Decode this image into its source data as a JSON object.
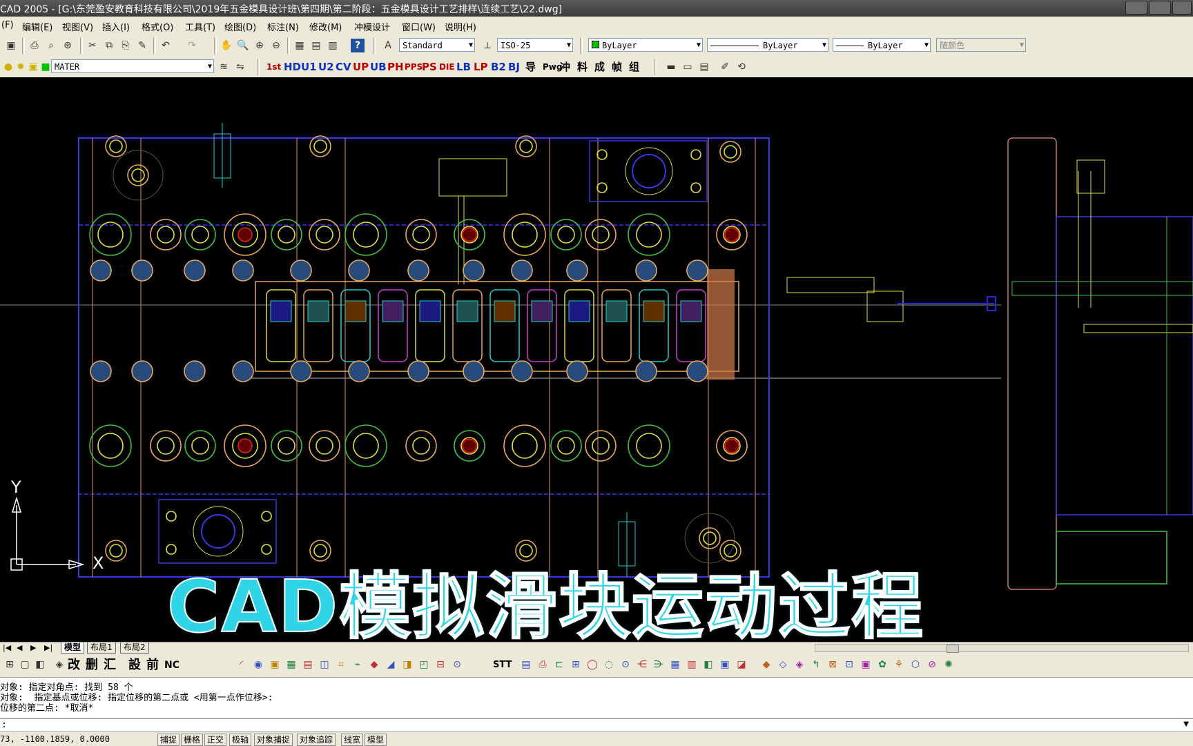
{
  "window": {
    "title": "CAD 2005 - [G:\\东莞盈安教育科技有限公司\\2019年五金模具设计班\\第四期\\第二阶段：五金模具设计工艺排样\\连续工艺\\22.dwg]"
  },
  "menu": {
    "items": [
      "(F)",
      "编辑(E)",
      "视图(V)",
      "插入(I)",
      "格式(O)",
      "工具(T)",
      "绘图(D)",
      "标注(N)",
      "修改(M)",
      "冲模设计",
      "窗口(W)",
      "说明(H)"
    ]
  },
  "properties": {
    "text_style": "Standard",
    "dim_style": "ISO-25",
    "color": "ByLayer",
    "linetype": "ByLayer",
    "lineweight": "ByLayer",
    "plot_style": "随颜色"
  },
  "layer": {
    "current": "MATER"
  },
  "custom_toolbar": {
    "labels": [
      "1st",
      "HD",
      "U1",
      "U2",
      "CV",
      "UP",
      "UB",
      "PH",
      "PPS",
      "PS",
      "DIE",
      "LB",
      "LP",
      "B2",
      "BJ",
      "导",
      "Pwg",
      "冲",
      "料",
      "成",
      "帧",
      "组"
    ]
  },
  "bottom_toolbar": {
    "labels": [
      "改",
      "删",
      "汇",
      "設",
      "前",
      "NC",
      "STT"
    ]
  },
  "canvas": {
    "caption": "CAD模拟滑块运动过程",
    "ucs_x": "X",
    "ucs_y": "Y"
  },
  "layout_tabs": [
    "模型",
    "布局1",
    "布局2"
  ],
  "command_history": [
    "对象: 指定对角点: 找到 58 个",
    "对象:  指定基点或位移: 指定位移的第二点或 <用第一点作位移>:",
    "位移的第二点: *取消*"
  ],
  "status": {
    "coordinates": "73, -1100.1859, 0.0000",
    "toggles": [
      "捕捉",
      "栅格",
      "正交",
      "极轴",
      "对象捕捉",
      "对象追踪",
      "线宽",
      "模型"
    ]
  },
  "colors": {
    "canvas_bg": "#000000",
    "caption": "#2fd4e6",
    "plate_orange": "#e8a95b",
    "blue": "#2a2ad8",
    "yellow": "#e0e040",
    "cyan": "#20d0d0",
    "green": "#40c040",
    "red": "#e02020",
    "magenta": "#d040d0"
  }
}
